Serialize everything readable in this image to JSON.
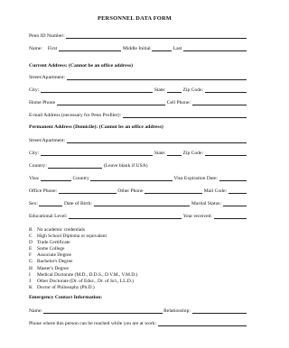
{
  "title": "PERSONNEL DATA FORM",
  "penn_id": "Penn ID Number:",
  "name": {
    "label": "Name:",
    "first": "First",
    "middle": "Middle Initial",
    "last": "Last"
  },
  "current": {
    "heading": "Current Address:  (Cannot be an office address)",
    "street": "Street/Apartment:",
    "city": "City:",
    "state": "State:",
    "zip": "Zip Code:",
    "home_phone": "Home Phone",
    "cell_phone": "Cell Phone:",
    "email": "E-mail Address (necessary for Penn Profiler):"
  },
  "permanent": {
    "heading": "Permanent Address (Domicile):  (Cannot be an office address)",
    "street": "Street/Apartment:",
    "city": "City:",
    "state": "State:",
    "zip": "Zip Code:",
    "country": "Country:",
    "country_note": "(Leave blank if USA)",
    "visa": "Visa:",
    "visa_country": "Country",
    "visa_exp": "Visa Expiration Date:",
    "office_phone": "Office Phone:",
    "other_phone": "Other Phone",
    "mail_code": "Mail Code:",
    "sex": "Sex:",
    "dob": "Date of Birth:",
    "marital": "Marital Status:",
    "edu_level": "Educational Level:",
    "year_received": "Year received:"
  },
  "education": [
    {
      "key": "B",
      "text": "No academic credentials"
    },
    {
      "key": "C",
      "text": "High School Diploma or equivalent"
    },
    {
      "key": "D",
      "text": "Trade Certificate"
    },
    {
      "key": "E",
      "text": "Some College"
    },
    {
      "key": "F",
      "text": "Associate Degree"
    },
    {
      "key": "G",
      "text": "Bachelor's Degree"
    },
    {
      "key": "H",
      "text": "Master's Degree"
    },
    {
      "key": "I",
      "text": "Medical Doctorate (M.D., D.D.S., D.V.M., V.M.D.)"
    },
    {
      "key": "J",
      "text": "Other Doctorate (Dr. of Educ., Dr. of Sci., LL.D.)"
    },
    {
      "key": "K",
      "text": "Doctor of Philosophy (Ph.D.)"
    }
  ],
  "emergency": {
    "heading": "Emergency Contact Information:",
    "name": "Name:",
    "relationship": "Relationship:",
    "phone": "Phone where this person can be reached while you are at work:"
  }
}
